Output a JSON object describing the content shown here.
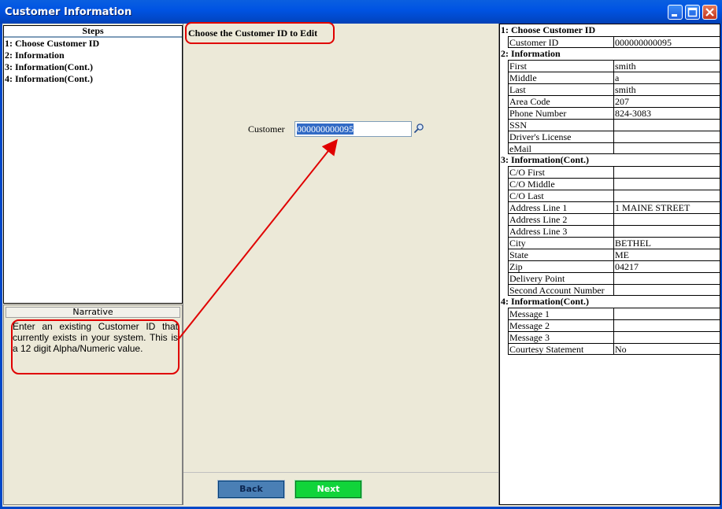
{
  "window": {
    "title": "Customer Information"
  },
  "steps": {
    "header": "Steps",
    "items": [
      {
        "label": "1: Choose Customer ID"
      },
      {
        "label": "2: Information"
      },
      {
        "label": "3: Information(Cont.)"
      },
      {
        "label": "4: Information(Cont.)"
      }
    ]
  },
  "narrative": {
    "header": "Narrative",
    "text": "Enter an existing Customer ID that currently exists in your system. This is a 12 digit Alpha/Numeric value."
  },
  "main": {
    "title": "Choose the Customer ID to Edit",
    "customer_label": "Customer",
    "customer_value": "000000000095",
    "back_label": "Back",
    "next_label": "Next"
  },
  "summary": {
    "sections": [
      {
        "title": "1: Choose Customer ID",
        "rows": [
          {
            "k": "Customer ID",
            "v": "000000000095"
          }
        ]
      },
      {
        "title": "2: Information",
        "rows": [
          {
            "k": "First",
            "v": "smith"
          },
          {
            "k": "Middle",
            "v": "a"
          },
          {
            "k": "Last",
            "v": "smith"
          },
          {
            "k": "Area Code",
            "v": "207"
          },
          {
            "k": "Phone Number",
            "v": "824-3083"
          },
          {
            "k": "SSN",
            "v": ""
          },
          {
            "k": "Driver's License",
            "v": ""
          },
          {
            "k": "eMail",
            "v": ""
          }
        ]
      },
      {
        "title": "3: Information(Cont.)",
        "rows": [
          {
            "k": "C/O First",
            "v": ""
          },
          {
            "k": "C/O Middle",
            "v": ""
          },
          {
            "k": "C/O Last",
            "v": ""
          },
          {
            "k": "Address Line 1",
            "v": "1 MAINE STREET"
          },
          {
            "k": "Address Line 2",
            "v": ""
          },
          {
            "k": "Address Line 3",
            "v": ""
          },
          {
            "k": "City",
            "v": "BETHEL"
          },
          {
            "k": "State",
            "v": "ME"
          },
          {
            "k": "Zip",
            "v": "04217"
          },
          {
            "k": "Delivery Point",
            "v": ""
          },
          {
            "k": "Second Account Number",
            "v": ""
          }
        ]
      },
      {
        "title": "4: Information(Cont.)",
        "rows": [
          {
            "k": "Message 1",
            "v": ""
          },
          {
            "k": "Message 2",
            "v": ""
          },
          {
            "k": "Message 3",
            "v": ""
          },
          {
            "k": "Courtesy Statement",
            "v": "No"
          }
        ]
      }
    ]
  },
  "colors": {
    "titlebar": "#0054E3",
    "callout": "#E00000",
    "next_button": "#11D43A",
    "back_button": "#4A7FB5",
    "selection": "#316AC5"
  },
  "icons": {
    "search": "magnifier-icon",
    "minimize": "minimize-icon",
    "maximize": "maximize-icon",
    "close": "close-icon"
  }
}
